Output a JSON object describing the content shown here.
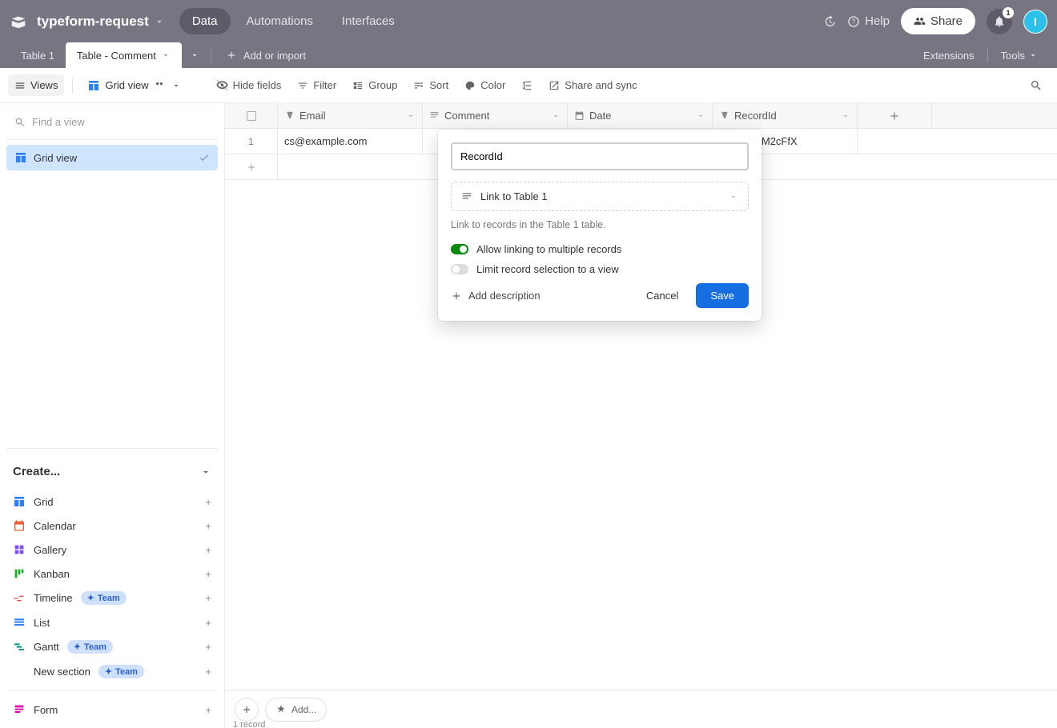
{
  "header": {
    "base_name": "typeform-request",
    "tabs": [
      "Data",
      "Automations",
      "Interfaces"
    ],
    "active_tab": 0,
    "help": "Help",
    "share": "Share",
    "notification_count": "1",
    "avatar_initial": "I"
  },
  "table_tabs": {
    "tabs": [
      "Table 1",
      "Table - Comment"
    ],
    "active": 1,
    "add_import": "Add or import",
    "extensions": "Extensions",
    "tools": "Tools"
  },
  "toolbar": {
    "views": "Views",
    "grid_view": "Grid view",
    "hide_fields": "Hide fields",
    "filter": "Filter",
    "group": "Group",
    "sort": "Sort",
    "color": "Color",
    "share_sync": "Share and sync"
  },
  "sidebar": {
    "find_placeholder": "Find a view",
    "views": [
      {
        "label": "Grid view",
        "active": true
      }
    ],
    "create_header": "Create...",
    "create_items": [
      {
        "label": "Grid",
        "icon": "grid",
        "color": "#2d7ff9"
      },
      {
        "label": "Calendar",
        "icon": "calendar",
        "color": "#e8603c"
      },
      {
        "label": "Gallery",
        "icon": "gallery",
        "color": "#7c4dff"
      },
      {
        "label": "Kanban",
        "icon": "kanban",
        "color": "#11af22"
      },
      {
        "label": "Timeline",
        "icon": "timeline",
        "color": "#e5484d",
        "team": true
      },
      {
        "label": "List",
        "icon": "list",
        "color": "#2d7ff9"
      },
      {
        "label": "Gantt",
        "icon": "gantt",
        "color": "#0d9488",
        "team": true
      },
      {
        "label": "New section",
        "icon": "",
        "color": "",
        "team": true
      }
    ],
    "team_label": "Team",
    "form_label": "Form"
  },
  "table": {
    "columns": [
      {
        "name": "Email",
        "type": "text"
      },
      {
        "name": "Comment",
        "type": "longtext"
      },
      {
        "name": "Date",
        "type": "date"
      },
      {
        "name": "RecordId",
        "type": "text"
      }
    ],
    "rows": [
      {
        "num": "1",
        "Email": "cs@example.com",
        "Comment": "",
        "Date": "",
        "RecordId": "recEPy9Ey8XPM2cFfX"
      }
    ],
    "footer_add": "Add...",
    "record_count": "1 record"
  },
  "popover": {
    "field_name": "RecordId",
    "field_type_label": "Link to Table 1",
    "description": "Link to records in the Table 1 table.",
    "toggle_multiple": "Allow linking to multiple records",
    "toggle_limit": "Limit record selection to a view",
    "add_description": "Add description",
    "cancel": "Cancel",
    "save": "Save"
  }
}
